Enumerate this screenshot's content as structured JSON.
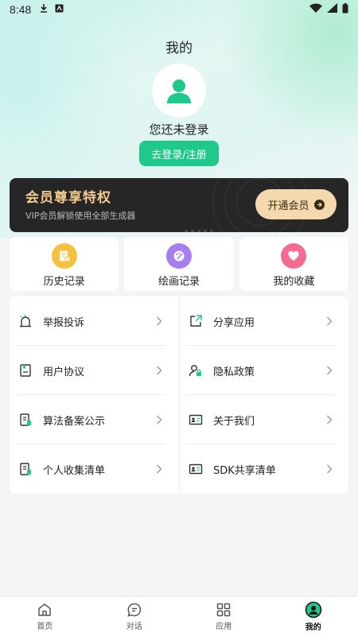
{
  "status_bar": {
    "time": "8:48"
  },
  "header": {
    "title": "我的"
  },
  "profile": {
    "login_status": "您还未登录",
    "login_button": "去登录/注册"
  },
  "vip": {
    "title": "会员尊享特权",
    "subtitle": "VIP会员解锁使用全部生成器",
    "button": "开通会员"
  },
  "quick_actions": [
    {
      "label": "历史记录",
      "icon": "history-icon",
      "color": "#f6c13f"
    },
    {
      "label": "绘画记录",
      "icon": "paint-icon",
      "color": "#a77ef0"
    },
    {
      "label": "我的收藏",
      "icon": "heart-icon",
      "color": "#f46a93"
    }
  ],
  "menu": {
    "left": [
      {
        "label": "举报投诉",
        "icon": "report-bell-icon"
      },
      {
        "label": "用户协议",
        "icon": "agreement-book-icon"
      },
      {
        "label": "算法备案公示",
        "icon": "document-icon"
      },
      {
        "label": "个人收集清单",
        "icon": "list-document-icon"
      }
    ],
    "right": [
      {
        "label": "分享应用",
        "icon": "share-icon"
      },
      {
        "label": "隐私政策",
        "icon": "privacy-user-lock-icon"
      },
      {
        "label": "关于我们",
        "icon": "id-card-icon"
      },
      {
        "label": "SDK共享清单",
        "icon": "sdk-card-icon"
      }
    ]
  },
  "tabbar": [
    {
      "label": "首页",
      "icon": "home-icon",
      "active": false
    },
    {
      "label": "对话",
      "icon": "chat-icon",
      "active": false
    },
    {
      "label": "应用",
      "icon": "apps-grid-icon",
      "active": false
    },
    {
      "label": "我的",
      "icon": "profile-icon",
      "active": true
    }
  ],
  "colors": {
    "accent": "#1fc98a",
    "vip_gold": "#f4c98e",
    "vip_bg": "#262626"
  }
}
